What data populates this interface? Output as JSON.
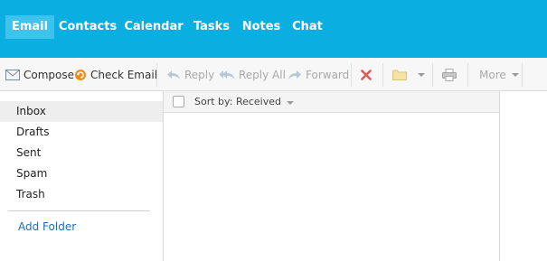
{
  "nav": {
    "tabs": [
      {
        "label": "Email"
      },
      {
        "label": "Contacts"
      },
      {
        "label": "Calendar"
      },
      {
        "label": "Tasks"
      },
      {
        "label": "Notes"
      },
      {
        "label": "Chat"
      }
    ],
    "active": "Email"
  },
  "toolbar": {
    "compose": "Compose",
    "check_email": "Check Email",
    "reply": "Reply",
    "reply_all": "Reply All",
    "forward": "Forward",
    "more": "More"
  },
  "sidebar": {
    "folders": [
      {
        "label": "Inbox"
      },
      {
        "label": "Drafts"
      },
      {
        "label": "Sent"
      },
      {
        "label": "Spam"
      },
      {
        "label": "Trash"
      }
    ],
    "add_folder": "Add Folder"
  },
  "list": {
    "sort_label": "Sort by: Received"
  },
  "colors": {
    "topbar": "#0aaee0",
    "active_tab": "#3ec3ec",
    "link": "#1a6fb8",
    "delete_icon": "#e05a5a"
  },
  "icons": [
    "envelope-icon",
    "refresh-icon",
    "reply-icon",
    "reply-all-icon",
    "forward-icon",
    "delete-icon",
    "folder-icon",
    "print-icon"
  ]
}
